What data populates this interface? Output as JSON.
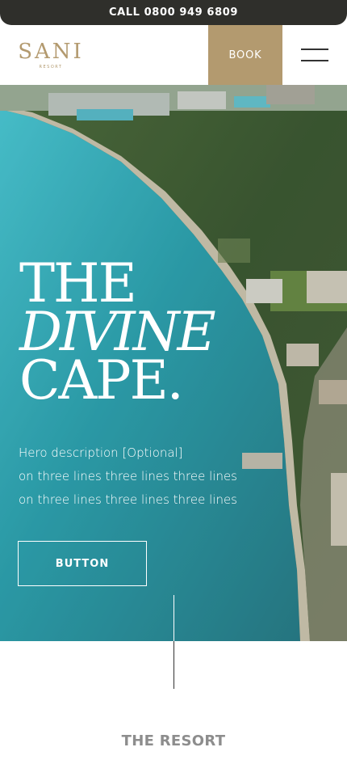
{
  "topbar": {
    "call_label": "CALL  0800 949 6809"
  },
  "header": {
    "logo_main": "SANI",
    "logo_sub": "RESORT",
    "book_label": "BOOK",
    "menu_icon": "hamburger-menu-icon"
  },
  "hero": {
    "title_line1": "THE",
    "title_line2": "DIVINE",
    "title_line3": "CAPE.",
    "desc_line1": "Hero description [Optional]",
    "desc_line2": "on three lines three lines three lines",
    "desc_line3": "on three lines three lines three lines",
    "button_label": "BUTTON"
  },
  "section": {
    "title": "THE RESORT"
  },
  "colors": {
    "topbar_bg": "#2f2f2b",
    "brand_gold": "#b39a6f",
    "sea": "#3fb6c4",
    "forest": "#3d5a2e"
  }
}
